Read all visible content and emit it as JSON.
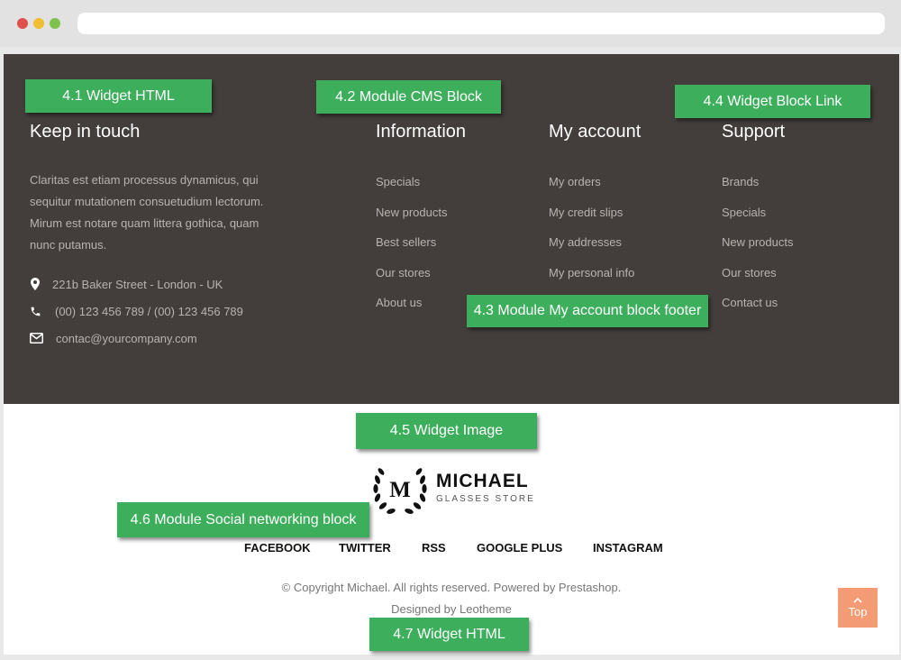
{
  "footer": {
    "about": {
      "title": "Keep in touch",
      "text": "Claritas est etiam processus dynamicus, qui sequitur mutationem consuetudium lectorum. Mirum est notare quam littera gothica, quam nunc putamus.",
      "address": "221b Baker Street - London - UK",
      "phone": "(00) 123 456 789 / (00) 123 456 789",
      "email": "contac@yourcompany.com"
    },
    "information": {
      "title": "Information",
      "links": [
        "Specials",
        "New products",
        "Best sellers",
        "Our stores",
        "About us"
      ]
    },
    "my_account": {
      "title": "My account",
      "links": [
        "My orders",
        "My credit slips",
        "My addresses",
        "My personal info"
      ]
    },
    "support": {
      "title": "Support",
      "links": [
        "Brands",
        "Specials",
        "New products",
        "Our stores",
        "Contact us"
      ]
    }
  },
  "badges": {
    "b41": "4.1 Widget HTML",
    "b42": "4.2 Module CMS Block",
    "b43": "4.3 Module My account block footer",
    "b44": "4.4 Widget Block Link",
    "b45": "4.5 Widget Image",
    "b46": "4.6 Module Social networking block",
    "b47": "4.7 Widget HTML"
  },
  "logo": {
    "initial": "M",
    "name": "MICHAEL",
    "subtitle": "GLASSES STORE"
  },
  "social": [
    "FACEBOOK",
    "TWITTER",
    "RSS",
    "GOOGLE PLUS",
    "INSTAGRAM"
  ],
  "copyright": "© Copyright Michael. All rights reserved. Powered by Prestashop.",
  "designed_by": "Designed by Leotheme",
  "top_button": "Top",
  "icons": {
    "address": "map-marker-icon",
    "phone": "phone-icon",
    "email": "envelope-icon",
    "top": "chevron-up-icon"
  },
  "colors": {
    "footer_bg": "#433e3c",
    "badge": "#3daf5c",
    "top_button": "#f39b75",
    "footer_text": "#b8b3ae"
  }
}
